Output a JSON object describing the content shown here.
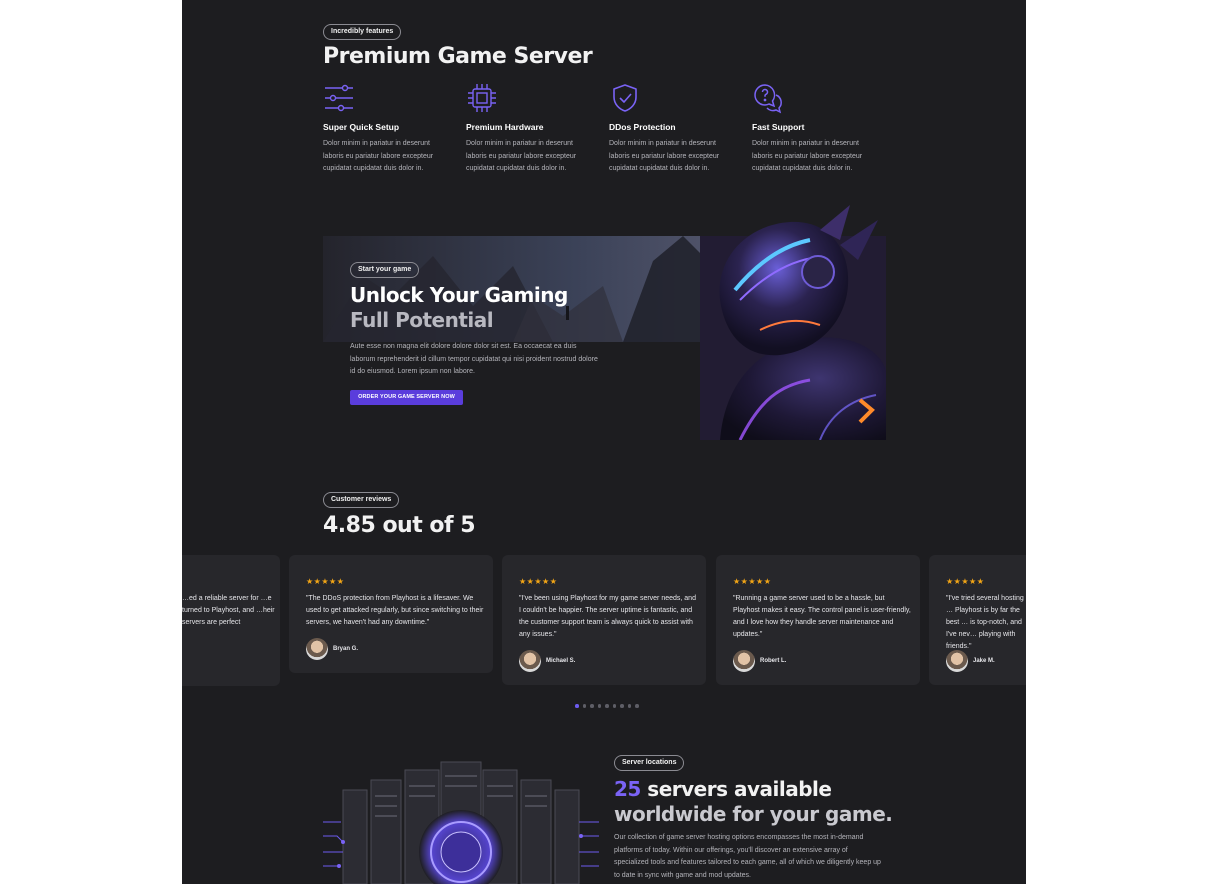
{
  "features_section": {
    "badge": "Incredibly features",
    "title": "Premium Game Server",
    "items": [
      {
        "icon": "sliders-icon",
        "title": "Super Quick Setup",
        "desc": "Dolor minim in pariatur in deserunt laboris eu pariatur labore excepteur cupidatat cupidatat duis dolor in."
      },
      {
        "icon": "cpu-chip-icon",
        "title": "Premium Hardware",
        "desc": "Dolor minim in pariatur in deserunt laboris eu pariatur labore excepteur cupidatat cupidatat duis dolor in."
      },
      {
        "icon": "shield-check-icon",
        "title": "DDos Protection",
        "desc": "Dolor minim in pariatur in deserunt laboris eu pariatur labore excepteur cupidatat cupidatat duis dolor in."
      },
      {
        "icon": "support-chat-icon",
        "title": "Fast Support",
        "desc": "Dolor minim in pariatur in deserunt laboris eu pariatur labore excepteur cupidatat cupidatat duis dolor in."
      }
    ]
  },
  "banner": {
    "badge": "Start your game",
    "title_line1": "Unlock Your Gaming",
    "title_line2": "Full Potential",
    "desc": "Aute esse non magna elit dolore dolore dolor sit est. Ea occaecat ea duis laborum reprehenderit id cillum tempor cupidatat qui nisi proident nostrud dolore id do eiusmod. Lorem ipsum non labore.",
    "cta": "ORDER YOUR GAME SERVER NOW"
  },
  "reviews_section": {
    "badge": "Customer reviews",
    "rating": "4.85 out of 5",
    "stars": "★★★★★",
    "reviews": [
      {
        "text": "…ed a reliable server for …e turned to Playhost, and …heir servers are perfect",
        "name": ""
      },
      {
        "text": "\"The DDoS protection from Playhost is a lifesaver. We used to get attacked regularly, but since switching to their servers, we haven't had any downtime.\"",
        "name": "Bryan G."
      },
      {
        "text": "\"I've been using Playhost for my game server needs, and I couldn't be happier. The server uptime is fantastic, and the customer support team is always quick to assist with any issues.\"",
        "name": "Michael S."
      },
      {
        "text": "\"Running a game server used to be a hassle, but Playhost makes it easy. The control panel is user-friendly, and I love how they handle server maintenance and updates.\"",
        "name": "Robert L."
      },
      {
        "text": "\"I've tried several hosting … Playhost is by far the best … is top-notch, and I've nev… playing with friends.\"",
        "name": "Jake M."
      }
    ],
    "page_count": 9,
    "active_page": 0
  },
  "locations_section": {
    "badge": "Server locations",
    "count": "25",
    "title_rest_line1": " servers available",
    "title_line2": "worldwide for your game.",
    "desc": "Our collection of game server hosting options encompasses the most in-demand platforms of today. Within our offerings, you'll discover an extensive array of specialized tools and features tailored to each game, all of which we diligently keep up to date in sync with game and mod updates."
  },
  "colors": {
    "accent": "#6d5cf0",
    "background": "#1d1d20",
    "card": "#27272b",
    "star": "#f2a516"
  }
}
